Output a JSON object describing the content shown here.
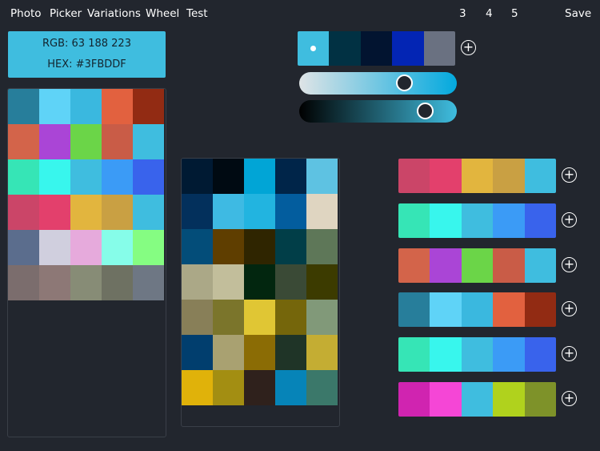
{
  "nav": {
    "photo": "Photo",
    "picker": "Picker",
    "variations": "Variations",
    "wheel": "Wheel",
    "test": "Test",
    "count_3": "3",
    "count_4": "4",
    "count_5": "5",
    "save": "Save"
  },
  "selected_color": {
    "rgb": "RGB: 63 188 223",
    "hex": "HEX: #3FBDDF",
    "swatch": "#3fbddf"
  },
  "left_grid": {
    "columns": 5,
    "colors": [
      "#277e9b",
      "#5fd3f7",
      "#3ab8df",
      "#e2613f",
      "#922b13",
      "#d3644a",
      "#aa45d6",
      "#6bd548",
      "#c95c47",
      "#3fbddf",
      "#36e5b6",
      "#38f6ed",
      "#3fbddf",
      "#3b9bf6",
      "#3963ec",
      "#cb4568",
      "#e3406c",
      "#e2b53e",
      "#c9a043",
      "#3fbddf",
      "#5b6d8d",
      "#d0cfde",
      "#e6aadc",
      "#86fde9",
      "#85fd82",
      "#7b6d6d",
      "#8d7876",
      "#878c76",
      "#6e7162",
      "#6e7784"
    ]
  },
  "middle_grid": {
    "columns": 5,
    "colors": [
      "#001a33",
      "#000a12",
      "#01a5d6",
      "#002549",
      "#5ec2e2",
      "#03305c",
      "#3ebae3",
      "#22b4e0",
      "#035d9e",
      "#dfd5c1",
      "#034d79",
      "#5f3e00",
      "#2f2500",
      "#013e48",
      "#5e7758",
      "#aba887",
      "#c2be9b",
      "#02260f",
      "#3a4a36",
      "#3c3b00",
      "#887f58",
      "#7b752b",
      "#e0c634",
      "#75660b",
      "#819979",
      "#013e6e",
      "#a9a171",
      "#8b6c05",
      "#1f3427",
      "#c4ad33",
      "#e0b20a",
      "#a38e12",
      "#2f211c",
      "#0684b8",
      "#3b786a"
    ]
  },
  "current_palette": {
    "colors": [
      "#3fbddf",
      "#013143",
      "#021430",
      "#0325b4",
      "#6a7181"
    ],
    "selected_index": 0
  },
  "sliders": {
    "saturation": {
      "value": 0.69,
      "start_color": "#dfe4e6",
      "end_color": "#03a9de"
    },
    "brightness": {
      "value": 0.84,
      "start_color": "#000000",
      "end_color": "#3fbddf"
    }
  },
  "palettes": [
    {
      "colors": [
        "#cb4568",
        "#e3406c",
        "#e2b53e",
        "#c9a043",
        "#3fbddf"
      ]
    },
    {
      "colors": [
        "#36e5b6",
        "#38f6ed",
        "#3fbddf",
        "#3b9bf6",
        "#3963ec"
      ]
    },
    {
      "colors": [
        "#d3644a",
        "#aa45d6",
        "#6bd548",
        "#c95c47",
        "#3fbddf"
      ]
    },
    {
      "colors": [
        "#277e9b",
        "#5fd3f7",
        "#3ab8df",
        "#e2613f",
        "#922b13"
      ]
    },
    {
      "colors": [
        "#36e5b6",
        "#38f6ed",
        "#3fbddf",
        "#3b9bf6",
        "#3963ec"
      ]
    },
    {
      "colors": [
        "#d024b0",
        "#f546d6",
        "#3fbddf",
        "#b0d21d",
        "#7e9229"
      ]
    }
  ],
  "icons": {
    "add": "plus-circle-icon",
    "add_glyph": "+"
  }
}
